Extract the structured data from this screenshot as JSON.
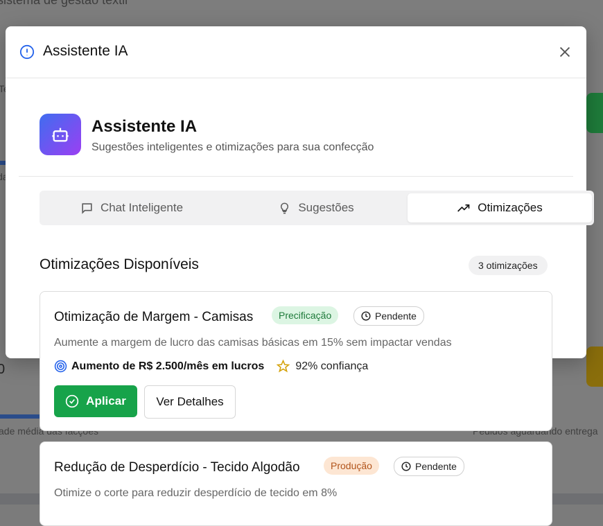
{
  "background": {
    "app_title": "sistema de gestão têxtil",
    "frag_left1": "Te",
    "frag_left2": "da",
    "frag_bottom_left": "ade média das facções",
    "frag_bottom_right": "Pedidos aguardando entrega",
    "frag_digit": "0"
  },
  "modal": {
    "title": "Assistente IA",
    "close_icon": "close-icon"
  },
  "hero": {
    "title": "Assistente IA",
    "subtitle": "Sugestões inteligentes e otimizações para sua confecção",
    "icon": "bot-icon"
  },
  "tabs": [
    {
      "label": "Chat Inteligente",
      "icon": "message-square-icon"
    },
    {
      "label": "Sugestões",
      "icon": "lightbulb-icon"
    },
    {
      "label": "Otimizações",
      "icon": "trending-up-icon",
      "active": true
    }
  ],
  "section": {
    "title": "Otimizações Disponíveis",
    "count_label": "3 otimizações"
  },
  "optimizations": [
    {
      "title": "Otimização de Margem - Camisas",
      "category": "Precificação",
      "status": "Pendente",
      "description": "Aumente a margem de lucro das camisas básicas em 15% sem impactar vendas",
      "impact": "Aumento de R$ 2.500/mês em lucros",
      "confidence": "92% confiança",
      "apply_label": "Aplicar",
      "details_label": "Ver Detalhes"
    },
    {
      "title": "Redução de Desperdício - Tecido Algodão",
      "category": "Produção",
      "status": "Pendente",
      "description": "Otimize o corte para reduzir desperdício de tecido em 8%"
    }
  ],
  "colors": {
    "primary_green": "#17a34a",
    "badge_gradient_start": "#3f6df0",
    "badge_gradient_end": "#9b3ff2",
    "info_blue": "#2563eb"
  }
}
